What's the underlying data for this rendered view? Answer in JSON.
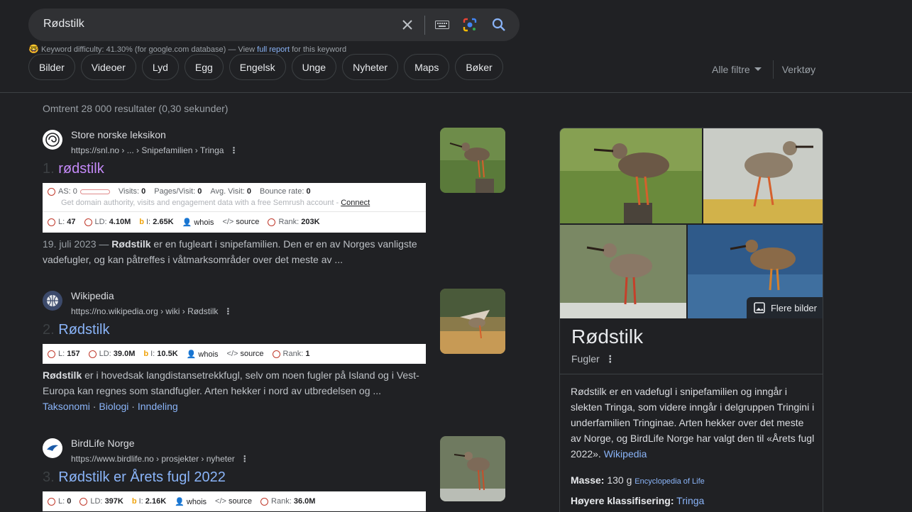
{
  "search": {
    "query": "Rødstilk"
  },
  "keyword": {
    "prefix": "Keyword difficulty:",
    "value": "41.30%",
    "db": "(for google.com database) — View",
    "link": "full report",
    "suffix": "for this keyword"
  },
  "chips": [
    "Bilder",
    "Videoer",
    "Lyd",
    "Egg",
    "Engelsk",
    "Unge",
    "Nyheter",
    "Maps",
    "Bøker"
  ],
  "tools": {
    "filters": "Alle filtre",
    "tools": "Verktøy"
  },
  "stats": "Omtrent 28 000 resultater (0,30 sekunder)",
  "results": [
    {
      "site": "Store norske leksikon",
      "crumb": "https://snl.no › ... › Snipefamilien › Tringa",
      "num": "1.",
      "title": "rødstilk",
      "seo_as": "AS: 0",
      "seo_visits": "Visits:",
      "seo_visits_v": "0",
      "seo_pages": "Pages/Visit:",
      "seo_pages_v": "0",
      "seo_avg": "Avg. Visit:",
      "seo_avg_v": "0",
      "seo_bounce": "Bounce rate:",
      "seo_bounce_v": "0",
      "seo_note": "Get domain authority, visits and engagement data with a free Semrush account -",
      "seo_connect": "Connect",
      "l": "L:",
      "l_v": "47",
      "ld": "LD:",
      "ld_v": "4.10M",
      "i": "I:",
      "i_v": "2.65K",
      "whois": "whois",
      "source": "source",
      "rank": "Rank:",
      "rank_v": "203K",
      "date": "19. juli 2023 —",
      "snip_b": "Rødstilk",
      "snip": "er en fugleart i snipefamilien. Den er en av Norges vanligste vadefugler, og kan påtreffes i våtmarksområder over det meste av ..."
    },
    {
      "site": "Wikipedia",
      "crumb": "https://no.wikipedia.org › wiki › Rødstilk",
      "num": "2.",
      "title": "Rødstilk",
      "l": "L:",
      "l_v": "157",
      "ld": "LD:",
      "ld_v": "39.0M",
      "i": "I:",
      "i_v": "10.5K",
      "whois": "whois",
      "source": "source",
      "rank": "Rank:",
      "rank_v": "1",
      "snip_b": "Rødstilk",
      "snip": "er i hovedsak langdistansetrekkfugl, selv om noen fugler på Island og i Vest-Europa kan regnes som standfugler. Arten hekker i nord av utbredelsen og ...",
      "links": [
        "Taksonomi",
        "Biologi",
        "Inndeling"
      ]
    },
    {
      "site": "BirdLife Norge",
      "crumb": "https://www.birdlife.no › prosjekter › nyheter",
      "num": "3.",
      "title": "Rødstilk er Årets fugl 2022",
      "l": "L:",
      "l_v": "0",
      "ld": "LD:",
      "ld_v": "397K",
      "i": "I:",
      "i_v": "2.16K",
      "whois": "whois",
      "source": "source",
      "rank": "Rank:",
      "rank_v": "36.0M"
    }
  ],
  "panel": {
    "more_images": "Flere bilder",
    "title": "Rødstilk",
    "subtitle": "Fugler",
    "desc": "Rødstilk er en vadefugl i snipefamilien og inngår i slekten Tringa, som videre inngår i delgruppen Tringini i underfamilien Tringinae. Arten hekker over det meste av Norge, og BirdLife Norge har valgt den til «Årets fugl 2022».",
    "desc_link": "Wikipedia",
    "mass_label": "Masse:",
    "mass_value": "130 g",
    "mass_source": "Encyclopedia of Life",
    "class_label": "Høyere klassifisering:",
    "class_value": "Tringa"
  },
  "colors": {
    "bg": "#202124",
    "link": "#8ab4f8",
    "visited": "#c58af9"
  }
}
